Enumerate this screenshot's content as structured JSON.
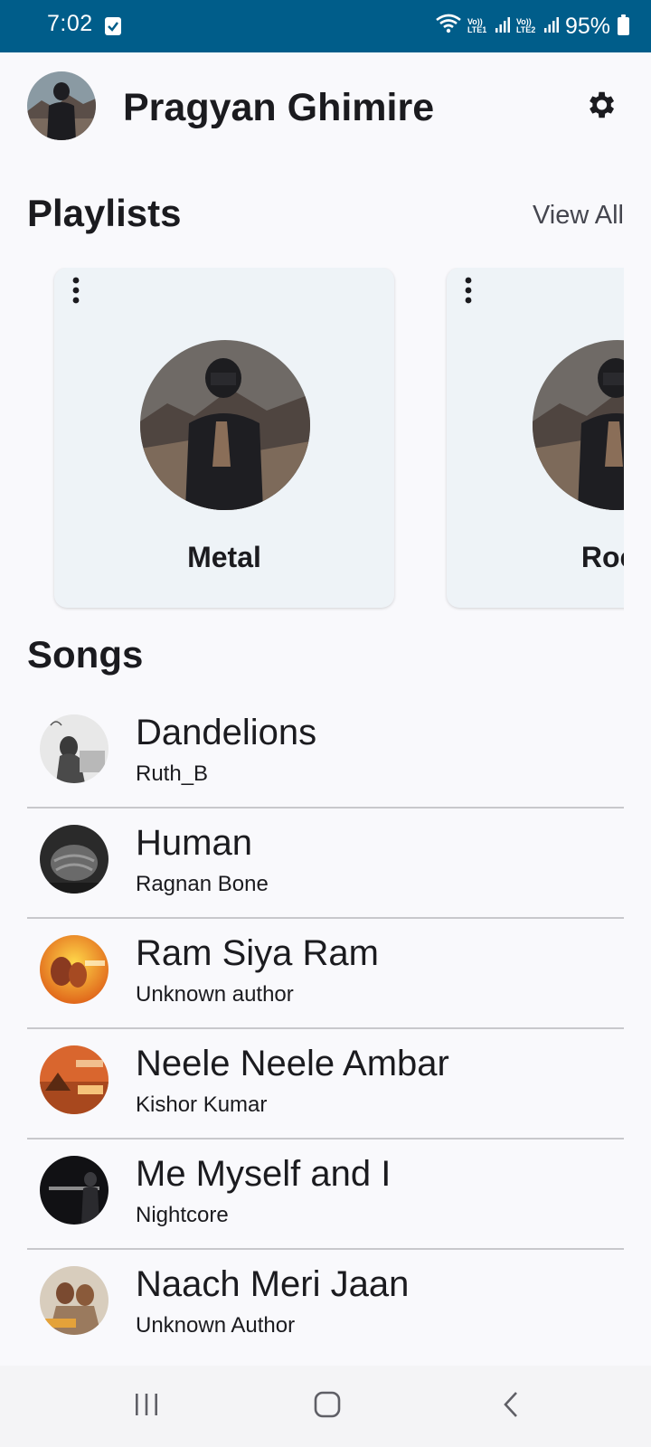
{
  "status_bar": {
    "time": "7:02",
    "battery": "95%",
    "sim1": "Vo)) LTE1",
    "sim2": "Vo)) LTE2"
  },
  "header": {
    "name": "Pragyan Ghimire",
    "settings_icon": "gear-icon"
  },
  "playlists": {
    "title": "Playlists",
    "view_all": "View All",
    "items": [
      {
        "name": "Metal"
      },
      {
        "name": "Rock"
      }
    ]
  },
  "songs": {
    "title": "Songs",
    "items": [
      {
        "title": "Dandelions",
        "artist": "Ruth_B"
      },
      {
        "title": "Human",
        "artist": "Ragnan Bone"
      },
      {
        "title": "Ram Siya Ram",
        "artist": "Unknown author"
      },
      {
        "title": "Neele Neele Ambar",
        "artist": "Kishor Kumar"
      },
      {
        "title": "Me Myself and I",
        "artist": "Nightcore"
      },
      {
        "title": "Naach Meri Jaan",
        "artist": "Unknown Author"
      }
    ]
  },
  "colors": {
    "status_bar": "#005d8a",
    "background": "#f9f9fc",
    "card": "#eef3f7",
    "divider": "#c8c8cc"
  }
}
